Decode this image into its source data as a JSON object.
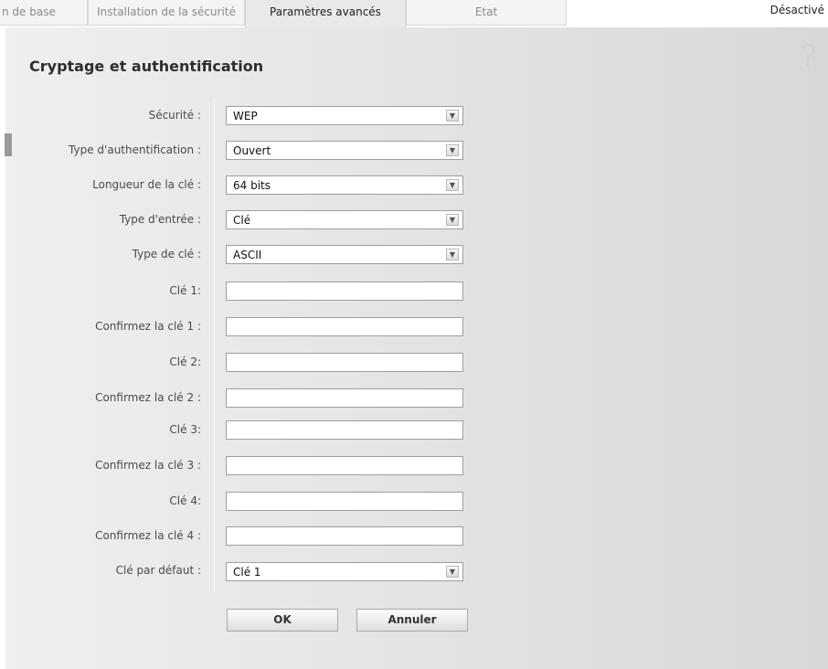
{
  "tabs": [
    {
      "label": "n de base"
    },
    {
      "label": "Installation de la sécurité"
    },
    {
      "label": "Paramètres avancés"
    },
    {
      "label": "Etat"
    }
  ],
  "status": "Désactivé",
  "title": "Cryptage et authentification",
  "help_icon": "?",
  "icons": {
    "help": "question-mark-icon",
    "dropdown": "chevron-down-icon"
  },
  "form": {
    "securite": {
      "label": "Sécurité :",
      "value": "WEP"
    },
    "type_auth": {
      "label": "Type d'authentification :",
      "value": "Ouvert"
    },
    "longueur": {
      "label": "Longueur de la clé :",
      "value": "64 bits"
    },
    "type_entree": {
      "label": "Type d'entrée :",
      "value": "Clé"
    },
    "type_cle": {
      "label": "Type de clé :",
      "value": "ASCII"
    },
    "cle1": {
      "label": "Clé 1:",
      "value": ""
    },
    "conf1": {
      "label": "Confirmez la clé 1 :",
      "value": ""
    },
    "cle2": {
      "label": "Clé 2:",
      "value": ""
    },
    "conf2": {
      "label": "Confirmez la clé 2 :",
      "value": ""
    },
    "cle3": {
      "label": "Clé 3:",
      "value": ""
    },
    "conf3": {
      "label": "Confirmez la clé 3 :",
      "value": ""
    },
    "cle4": {
      "label": "Clé 4:",
      "value": ""
    },
    "conf4": {
      "label": "Confirmez la clé 4 :",
      "value": ""
    },
    "defaut": {
      "label": "Clé par défaut :",
      "value": "Clé 1"
    }
  },
  "buttons": {
    "ok": "OK",
    "cancel": "Annuler"
  }
}
